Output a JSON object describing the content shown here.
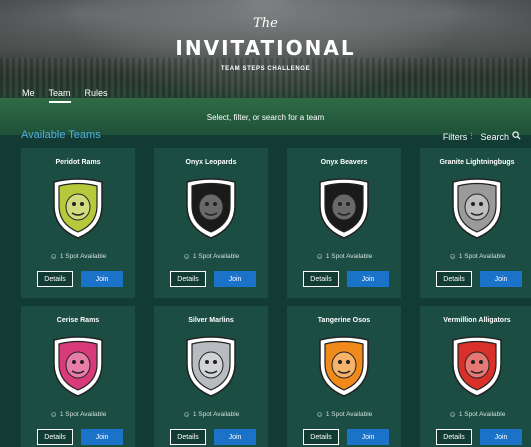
{
  "header": {
    "title_small": "The",
    "title_big": "INVITATIONAL",
    "title_sub": "TEAM STEPS CHALLENGE"
  },
  "nav": {
    "tabs": [
      {
        "label": "Me"
      },
      {
        "label": "Team",
        "active": true
      },
      {
        "label": "Rules"
      }
    ]
  },
  "subtitle": "Select, filter, or search for a team",
  "section_title": "Available Teams",
  "tools": {
    "filters_label": "Filters",
    "filters_icon": "filter-icon",
    "search_label": "Search",
    "search_icon": "search-icon"
  },
  "colors": {
    "background": "#123c33",
    "card": "#1b4d42",
    "accent": "#4fb0e0",
    "join_button": "#1a73c9"
  },
  "teams": [
    {
      "name": "Peridot Rams",
      "spots": "1 Spot Available",
      "details": "Details",
      "join": "Join",
      "logo_color": "#b5c93a",
      "logo_icon": "ram-icon"
    },
    {
      "name": "Onyx Leopards",
      "spots": "1 Spot Available",
      "details": "Details",
      "join": "Join",
      "logo_color": "#1a1a1a",
      "logo_icon": "leopard-icon"
    },
    {
      "name": "Onyx Beavers",
      "spots": "1 Spot Available",
      "details": "Details",
      "join": "Join",
      "logo_color": "#1a1a1a",
      "logo_icon": "beaver-icon"
    },
    {
      "name": "Granite Lightningbugs",
      "spots": "1 Spot Available",
      "details": "Details",
      "join": "Join",
      "logo_color": "#9a9a9a",
      "logo_icon": "lightningbug-icon"
    },
    {
      "name": "Cerise Rams",
      "spots": "1 Spot Available",
      "details": "Details",
      "join": "Join",
      "logo_color": "#d93a7a",
      "logo_icon": "ram-icon"
    },
    {
      "name": "Silver Marlins",
      "spots": "1 Spot Available",
      "details": "Details",
      "join": "Join",
      "logo_color": "#b8bcc0",
      "logo_icon": "marlin-icon"
    },
    {
      "name": "Tangerine Osos",
      "spots": "1 Spot Available",
      "details": "Details",
      "join": "Join",
      "logo_color": "#f08a1c",
      "logo_icon": "bear-icon"
    },
    {
      "name": "Vermillion Alligators",
      "spots": "1 Spot Available",
      "details": "Details",
      "join": "Join",
      "logo_color": "#d9302a",
      "logo_icon": "alligator-icon"
    }
  ]
}
